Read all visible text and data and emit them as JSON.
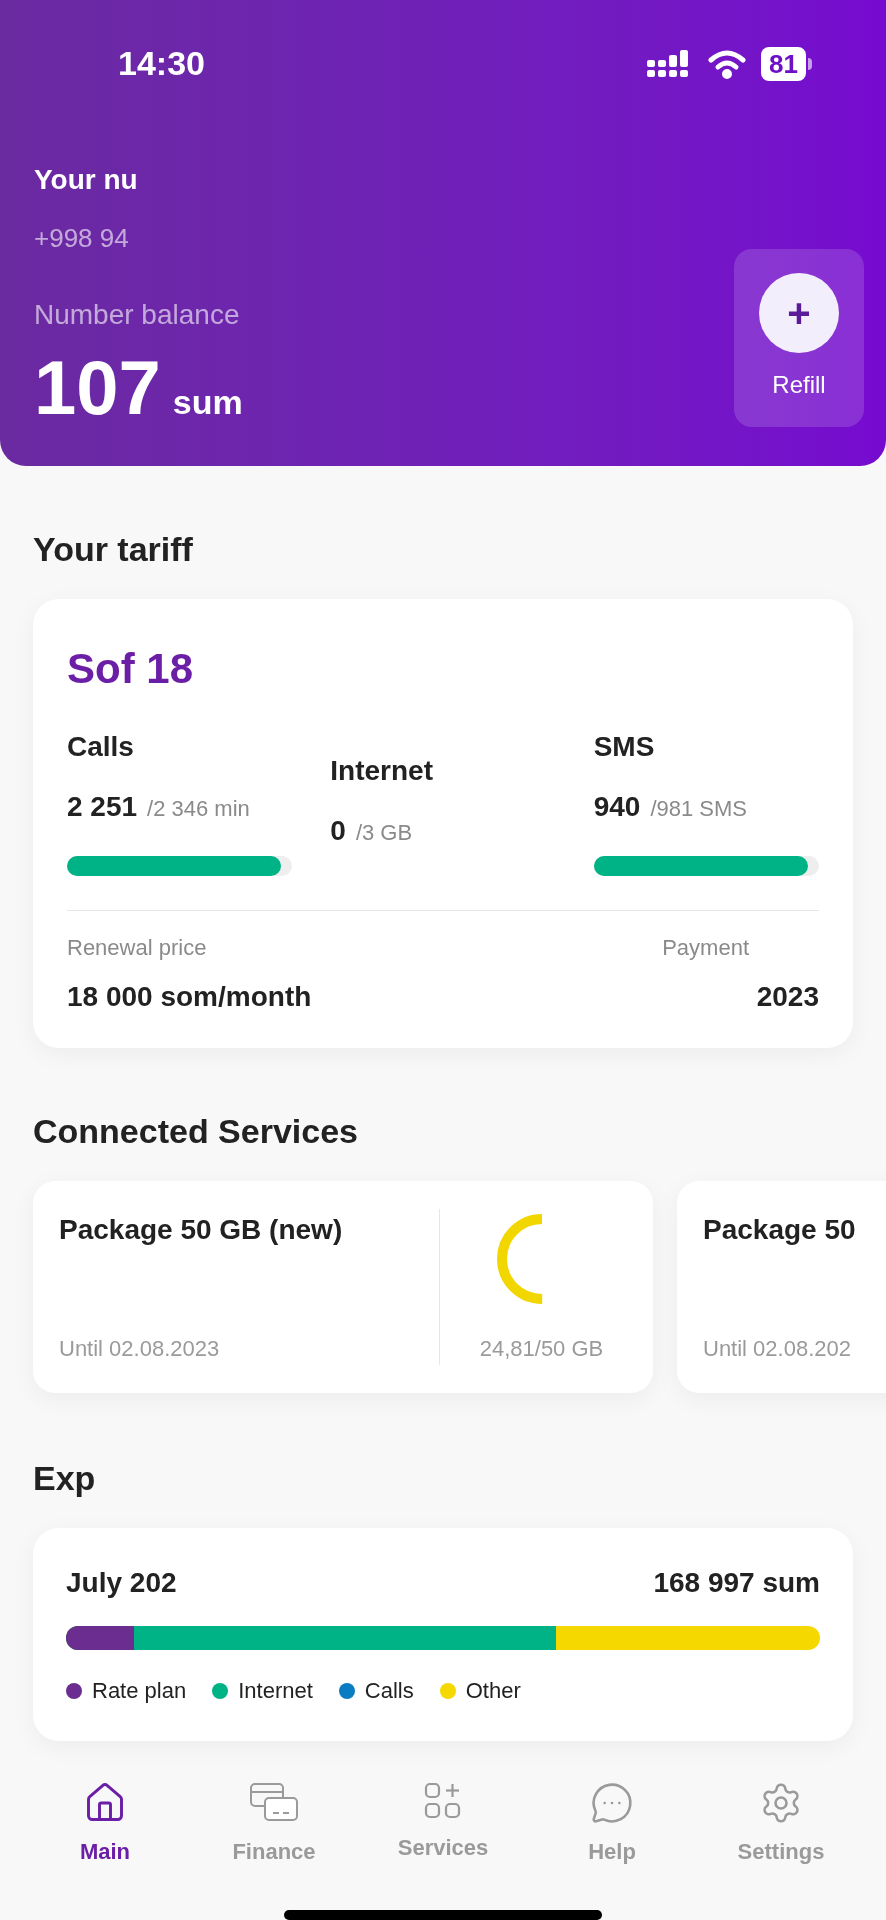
{
  "status_bar": {
    "time": "14:30",
    "battery": "81"
  },
  "header": {
    "number_label": "Your nu",
    "number": "+998 94",
    "balance_label": "Number balance",
    "balance": "107",
    "currency": "sum",
    "refill": {
      "icon": "+",
      "label": "Refill"
    }
  },
  "tariff": {
    "title": "Your tariff",
    "name": "Sof 18",
    "counters": [
      {
        "kind": "bar",
        "label": "Calls",
        "value": "2 251",
        "limit": "/2 346 min",
        "level": 0.95
      },
      {
        "kind": "plain",
        "label": "Internet",
        "value": "0",
        "limit": "/3 GB"
      },
      {
        "kind": "bar",
        "label": "SMS",
        "value": "940",
        "limit": "/981 SMS",
        "level": 0.95
      }
    ],
    "renewal_label": "Renewal price",
    "renewal_value": "18 000 som/month",
    "payment_label": "Payment",
    "payment_value": "2023"
  },
  "services": {
    "title": "Connected Services",
    "packages": [
      {
        "name": "Package 50 GB (new)",
        "until": "Until 02.08.2023",
        "usage": "24,81/50 GB",
        "level": 0.5
      },
      {
        "name": "Package 50",
        "until": "Until 02.08.202"
      }
    ]
  },
  "expenses": {
    "title": "Exp",
    "month": "July 202",
    "total": "168 997 sum",
    "legend": [
      {
        "label": "Rate plan",
        "color": "#6b2d8f",
        "level": 0.09
      },
      {
        "label": "Internet",
        "color": "#00b386",
        "level": 0.65
      },
      {
        "label": "Calls",
        "color": "#0a7cc2"
      },
      {
        "label": "Other",
        "color": "#f5d800"
      }
    ]
  },
  "nav": [
    {
      "label": "Main",
      "selected": true
    },
    {
      "label": "Finance",
      "selected": false
    },
    {
      "label": "Services",
      "selected": false
    },
    {
      "label": "Help",
      "selected": false
    },
    {
      "label": "Settings",
      "selected": false
    }
  ]
}
